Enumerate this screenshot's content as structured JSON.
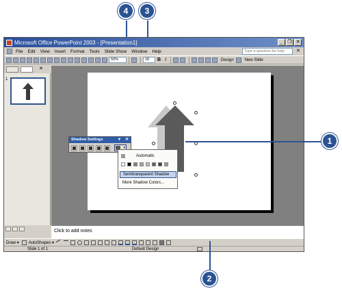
{
  "window": {
    "title": "Microsoft Office PowerPoint 2003 - [Presentation1]",
    "controls": [
      "_",
      "❐",
      "✕"
    ]
  },
  "menubar": {
    "items": [
      "File",
      "Edit",
      "View",
      "Insert",
      "Format",
      "Tools",
      "Slide Show",
      "Window",
      "Help"
    ],
    "ask_placeholder": "Type a question for help",
    "close": "✕"
  },
  "toolbar": {
    "zoom": "50%",
    "font_size": "18",
    "bold": "B",
    "italic": "I",
    "design": "Design",
    "new_slide": "New Slide"
  },
  "thumbnails": {
    "slide_number": "1",
    "close": "✕"
  },
  "shadow_settings": {
    "title": "Shadow Settings",
    "controls": [
      "▾",
      "✕"
    ],
    "color_arrow": "▾"
  },
  "shadow_color_menu": {
    "automatic": "Automatic",
    "swatches": [
      "#ffffff",
      "#000000",
      "#808080",
      "#a0a0a0",
      "#c0c0c0",
      "#606060",
      "#404040",
      "#9a9a9a"
    ],
    "semitransparent": "Semitransparent Shadow",
    "more_colors": "More Shadow Colors..."
  },
  "notes": {
    "placeholder": "Click to add notes"
  },
  "drawing_toolbar": {
    "draw": "Draw ▾",
    "autoshapes": "AutoShapes ▾"
  },
  "status": {
    "slide": "Slide 1 of 1",
    "design": "Default Design"
  },
  "callouts": {
    "c1": "1",
    "c2": "2",
    "c3": "3",
    "c4": "4"
  },
  "colors": {
    "titlebar": "#2a4f9b",
    "callout": "#2b5394",
    "arrow_fill": "#5a5a5a",
    "arrow_shadow": "#c8c8c8"
  }
}
